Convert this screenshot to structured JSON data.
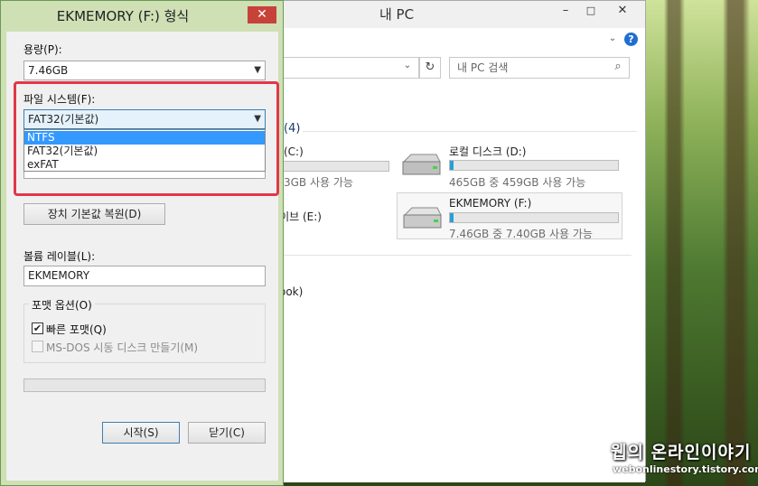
{
  "explorer": {
    "title": "내 PC",
    "window_buttons": [
      "–",
      "□",
      "✕"
    ],
    "search_placeholder": "내 PC 검색",
    "group_count": "(4)",
    "drives": [
      {
        "name": "(C:)",
        "usage": "3GB 사용 가능",
        "fill_fraction": 0.0
      },
      {
        "name": "로컬 디스크 (D:)",
        "usage": "465GB 중 459GB 사용 가능",
        "fill_fraction": 0.013
      },
      {
        "name": "드라이브 (E:)"
      },
      {
        "name": "EKMEMORY (F:)",
        "usage": "7.46GB 중 7.40GB 사용 가능",
        "fill_fraction": 0.01
      }
    ],
    "network_item": "ook)"
  },
  "dialog": {
    "title": "EKMEMORY (F:) 형식",
    "close_glyph": "✕",
    "capacity_label": "용량(P):",
    "capacity_value": "7.46GB",
    "filesystem_label": "파일 시스템(F):",
    "filesystem_value": "FAT32(기본값)",
    "filesystem_options": [
      "NTFS",
      "FAT32(기본값)",
      "exFAT"
    ],
    "selected_option": "NTFS",
    "restore_button": "장치 기본값 복원(D)",
    "volume_label": "볼륨 레이블(L):",
    "volume_value": "EKMEMORY",
    "format_options_label": "포맷 옵션(O)",
    "quick_format_label": "빠른 포맷(Q)",
    "quick_format_checked": true,
    "msdos_label": "MS-DOS 시동 디스크 만들기(M)",
    "msdos_checked": false,
    "progress": 0,
    "start_button": "시작(S)",
    "close_button": "닫기(C)"
  },
  "watermark": {
    "title": "웹의 온라인이야기",
    "url": "webonlinestory.tistory.com"
  },
  "colors": {
    "accent_blue": "#26a0da",
    "selection_blue": "#3399ff",
    "highlight_red": "#e0384a",
    "close_red": "#c7433a"
  }
}
